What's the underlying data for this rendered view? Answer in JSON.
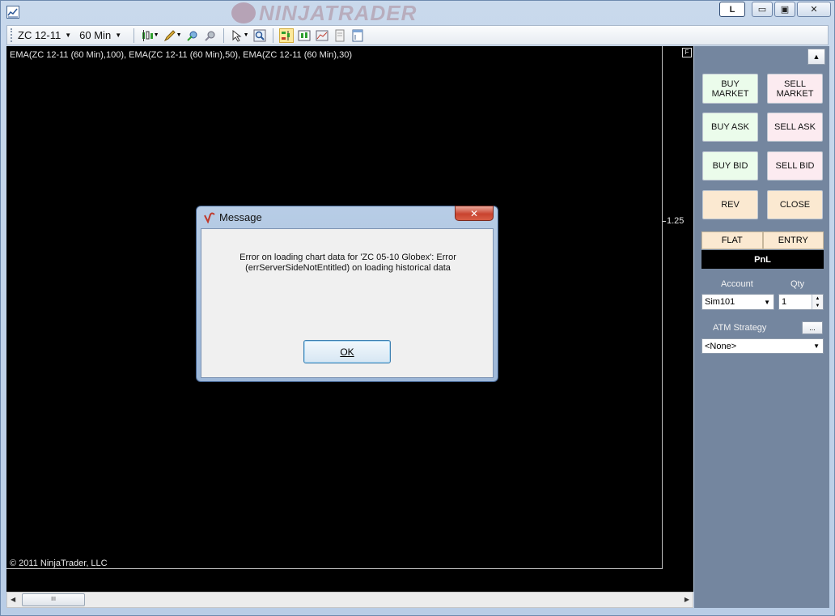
{
  "window": {
    "brand": "NINJATRADER",
    "btn_l": "L",
    "btn_min": "▭",
    "btn_max": "▣",
    "btn_close": "✕"
  },
  "toolbar": {
    "instrument": "ZC 12-11",
    "interval": "60 Min",
    "icons": [
      "candlestick-icon",
      "pencil-icon",
      "indicator-icon",
      "strategy-icon",
      "cursor-icon",
      "zoom-icon",
      "chart-trader-icon",
      "data-box-icon",
      "chart-style-icon",
      "properties-icon",
      "template-icon"
    ]
  },
  "chart": {
    "indicators": "EMA(ZC 12-11 (60 Min),100), EMA(ZC 12-11 (60 Min),50), EMA(ZC 12-11 (60 Min),30)",
    "y_value": "1.25",
    "f_label": "F",
    "copyright": "© 2011 NinjaTrader, LLC",
    "background": "#000000"
  },
  "hscroll": {
    "thumb_grip": "III"
  },
  "panel": {
    "buy_market": "BUY MARKET",
    "sell_market": "SELL MARKET",
    "buy_ask": "BUY ASK",
    "sell_ask": "SELL ASK",
    "buy_bid": "BUY BID",
    "sell_bid": "SELL BID",
    "rev": "REV",
    "close": "CLOSE",
    "flat": "FLAT",
    "entry": "ENTRY",
    "pnl": "PnL",
    "account_label": "Account",
    "qty_label": "Qty",
    "account_value": "Sim101",
    "qty_value": "1",
    "atm_label": "ATM Strategy",
    "atm_dots": "...",
    "atm_value": "<None>"
  },
  "dialog": {
    "title": "Message",
    "line1": "Error on loading chart data for 'ZC 05-10 Globex': Error",
    "line2": "(errServerSideNotEntitled) on loading historical data",
    "ok_label": "OK",
    "close_label": "✕"
  }
}
